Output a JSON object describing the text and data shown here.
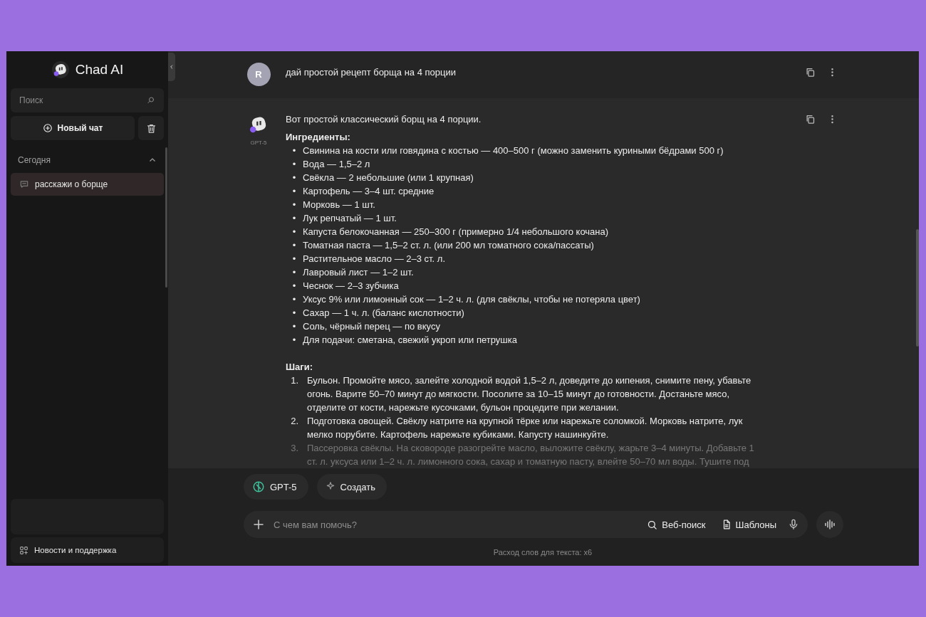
{
  "sidebar": {
    "brand": "Chad AI",
    "search": {
      "placeholder": "Поиск"
    },
    "new_chat": "Новый чат",
    "section": {
      "title": "Сегодня",
      "expanded": true
    },
    "chats": [
      {
        "title": "расскажи о борще",
        "selected": true
      }
    ],
    "footer_link": "Новости и поддержка"
  },
  "messages": [
    {
      "kind": "user",
      "avatar": "R",
      "text": "дай простой рецепт борща на 4 порции"
    },
    {
      "kind": "assistant",
      "model": "GPT-5",
      "intro": "Вот простой классический борщ на 4 порции.",
      "ingredients_title": "Ингредиенты:",
      "ingredients": [
        {
          "bullet": "•",
          "text": "Свинина на кости или говядина с костью — 400–500 г (можно заменить куриными бёдрами 500 г)"
        },
        {
          "bullet": "•",
          "text": "Вода — 1,5–2 л"
        },
        {
          "bullet": "•",
          "text": "Свёкла — 2 небольшие (или 1 крупная)"
        },
        {
          "bullet": "•",
          "text": "Картофель — 3–4 шт. средние"
        },
        {
          "bullet": "•",
          "text": "Морковь — 1 шт."
        },
        {
          "bullet": "•",
          "text": "Лук репчатый — 1 шт."
        },
        {
          "bullet": "•",
          "text": "Капуста белокочанная — 250–300 г (примерно 1/4 небольшого кочана)"
        },
        {
          "bullet": "•",
          "text": "Томатная паста — 1,5–2 ст. л. (или 200 мл томатного сока/пассаты)"
        },
        {
          "bullet": "•",
          "text": "Растительное масло — 2–3 ст. л."
        },
        {
          "bullet": "•",
          "text": "Лавровый лист — 1–2 шт."
        },
        {
          "bullet": "•",
          "text": "Чеснок — 2–3 зубчика"
        },
        {
          "bullet": "•",
          "text": "Уксус 9% или лимонный сок — 1–2 ч. л. (для свёклы, чтобы не потеряла цвет)"
        },
        {
          "bullet": "•",
          "text": "Сахар — 1 ч. л. (баланс кислотности)"
        },
        {
          "bullet": "•",
          "text": "Соль, чёрный перец — по вкусу"
        },
        {
          "bullet": "•",
          "text": "Для подачи: сметана, свежий укроп или петрушка"
        }
      ],
      "steps_title": "Шаги:",
      "steps": [
        {
          "number": "1.",
          "text": "Бульон. Промойте мясо, залейте холодной водой 1,5–2 л, доведите до кипения, снимите пену, убавьте огонь. Варите 50–70 минут до мягкости. Посолите за 10–15 минут до готовности. Достаньте мясо, отделите от кости, нарежьте кусочками, бульон процедите при желании.",
          "faded": false
        },
        {
          "number": "2.",
          "text": "Подготовка овощей. Свёклу натрите на крупной тёрке или нарежьте соломкой. Морковь натрите, лук мелко порубите. Картофель нарежьте кубиками. Капусту нашинкуйте.",
          "faded": false
        },
        {
          "number": "3.",
          "text": "Пассеровка свёклы. На сковороде разогрейте масло, выложите свёклу, жарьте 3–4 минуты. Добавьте 1 ст. л. уксуса или 1–2 ч. л. лимонного сока, сахар и томатную пасту, влейте 50–70 мл воды. Тушите под",
          "faded": true
        }
      ]
    }
  ],
  "chips": [
    {
      "kind": "model",
      "label": "GPT-5"
    },
    {
      "kind": "create",
      "label": "Создать"
    }
  ],
  "composer": {
    "placeholder": "С чем вам помочь?",
    "tools": [
      {
        "kind": "search",
        "label": "Веб-поиск"
      },
      {
        "kind": "templates",
        "label": "Шаблоны"
      }
    ]
  },
  "footer_note": "Расход слов для текста: x6"
}
